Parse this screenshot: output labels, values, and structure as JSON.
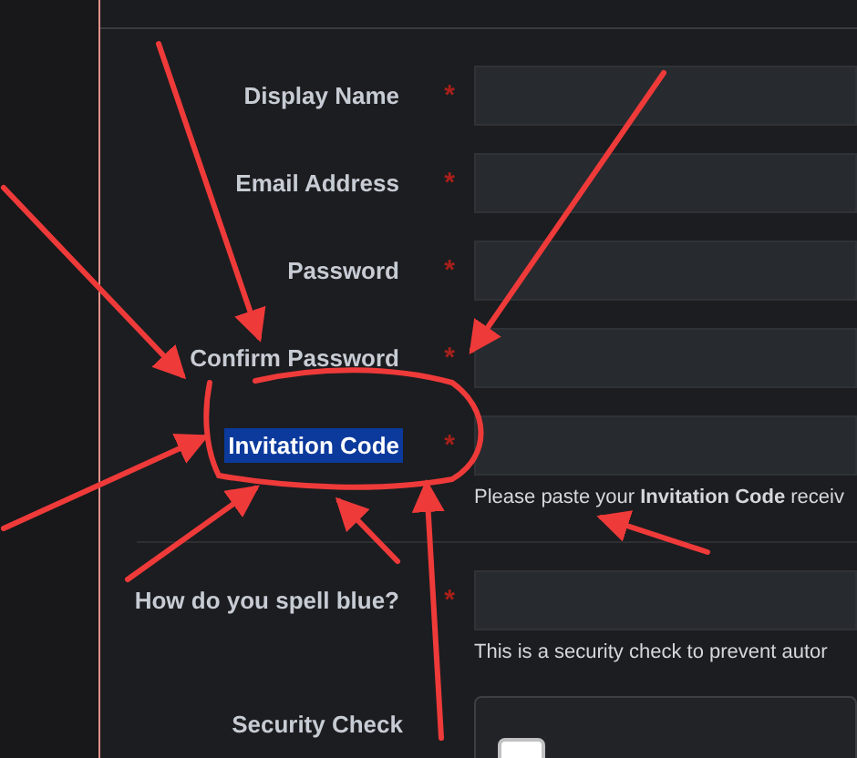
{
  "form": {
    "fields": [
      {
        "label": "Display Name",
        "required": true,
        "required_mark": "*",
        "highlighted": false
      },
      {
        "label": "Email Address",
        "required": true,
        "required_mark": "*",
        "highlighted": false
      },
      {
        "label": "Password",
        "required": true,
        "required_mark": "*",
        "highlighted": false
      },
      {
        "label": "Confirm Password",
        "required": true,
        "required_mark": "*",
        "highlighted": false
      },
      {
        "label": "Invitation Code",
        "required": true,
        "required_mark": "*",
        "highlighted": true,
        "hint": "Please paste your **Invitation Code** receiv"
      }
    ],
    "question": {
      "label": "How do you spell blue?",
      "required": true,
      "required_mark": "*",
      "hint": "This is a security check to prevent autor"
    },
    "security_check": {
      "label": "Security Check",
      "checked": false
    }
  }
}
